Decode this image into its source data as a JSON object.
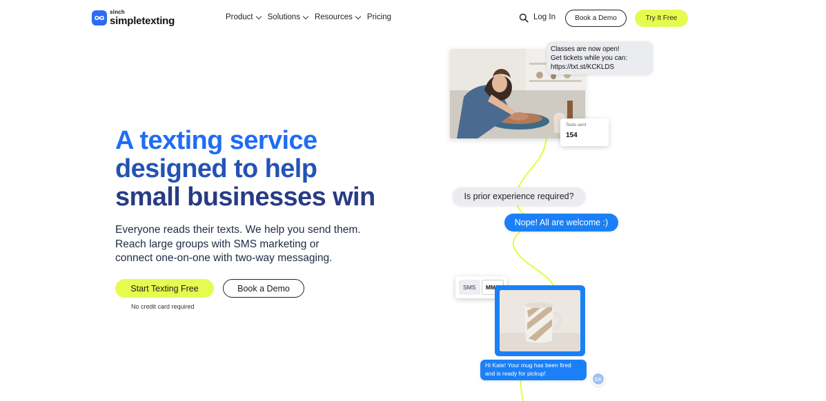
{
  "brand": {
    "parent": "sinch",
    "name": "simpletexting",
    "accent": "#1f6cf6",
    "highlight": "#e6fb4f"
  },
  "nav": {
    "menu": [
      {
        "label": "Product",
        "has_dropdown": true
      },
      {
        "label": "Solutions",
        "has_dropdown": true
      },
      {
        "label": "Resources",
        "has_dropdown": true
      },
      {
        "label": "Pricing",
        "has_dropdown": false
      }
    ],
    "search_icon": "search-icon",
    "login_label": "Log In",
    "demo_label": "Book a Demo",
    "try_label": "Try It Free"
  },
  "hero": {
    "title_lines": [
      "A texting service",
      "designed to help",
      "small businesses win"
    ],
    "subtitle_lines": [
      "Everyone reads their texts. We help you send them.",
      "Reach large groups with SMS marketing or",
      "connect one-on-one with two-way messaging."
    ],
    "cta_primary": "Start Texting Free",
    "cta_secondary": "Book a Demo",
    "cta_note": "No credit card required"
  },
  "visual": {
    "top_message_lines": [
      "Classes are now open!",
      "Get tickets while you can:",
      "https://txt.st/KCKLDS"
    ],
    "stat_label": "Texts sent",
    "stat_value": "154",
    "question": "Is prior experience required?",
    "answer": "Nope! All are welcome :)",
    "toggle": {
      "sms": "SMS",
      "mms": "MMS",
      "selected": "MMS"
    },
    "bottom_message_lines": [
      "Hi Kate! Your mug has been fired",
      "and is ready for pickup!"
    ],
    "avatar_initials": "GK"
  }
}
